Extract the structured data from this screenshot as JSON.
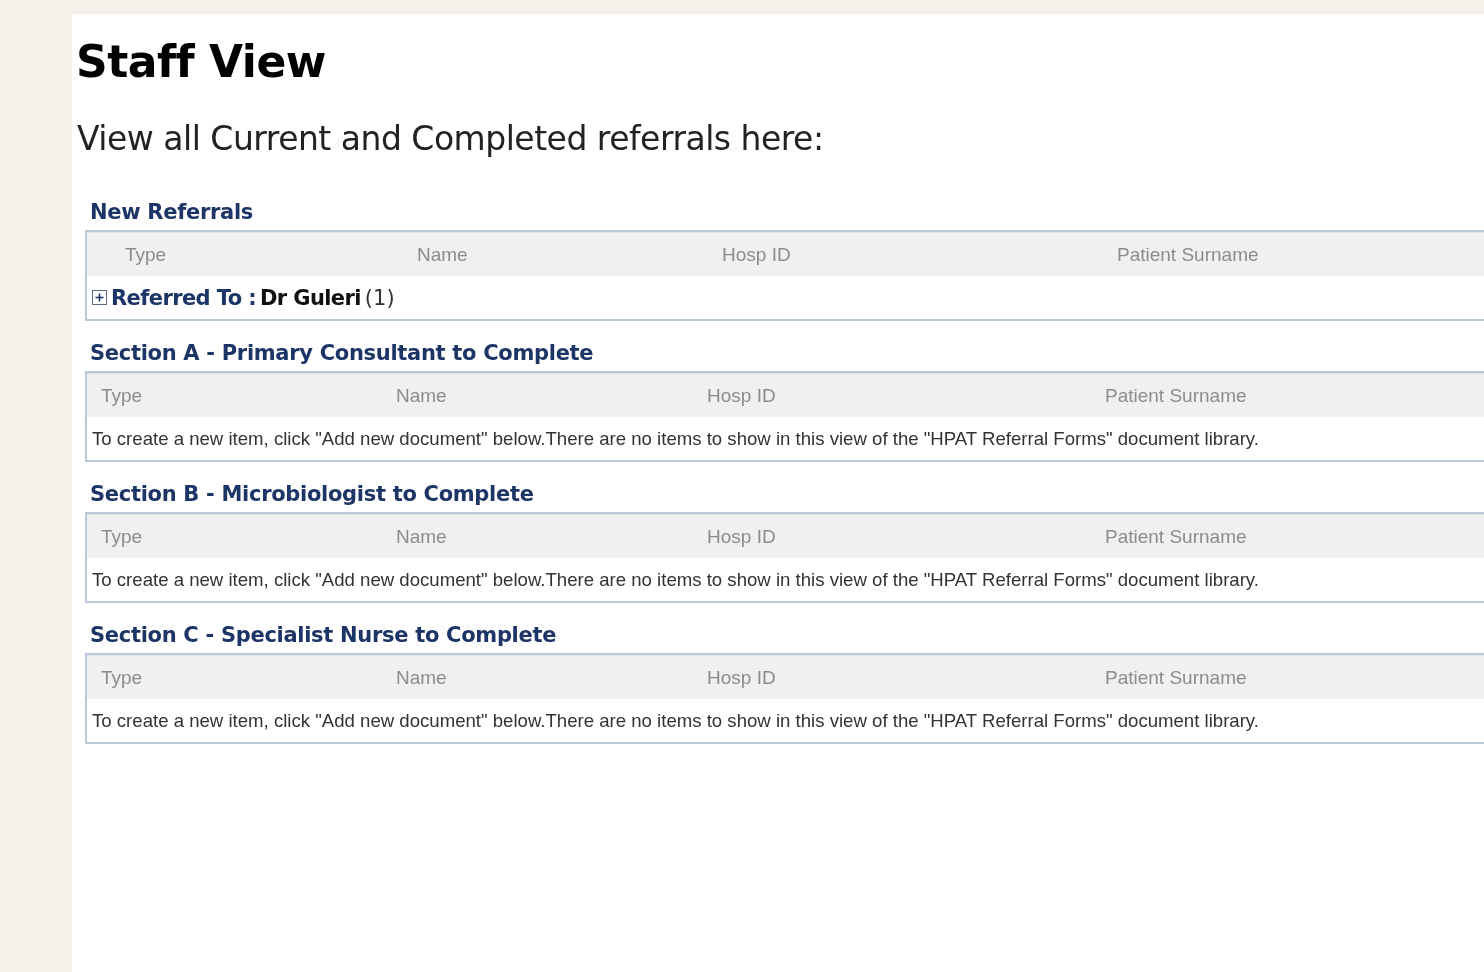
{
  "page": {
    "title": "Staff View",
    "subtitle": "View all Current and Completed referrals here:"
  },
  "sections": [
    {
      "kind": "grouped",
      "title": "New Referrals",
      "columns": [
        "Type",
        "Name",
        "Hosp ID",
        "Patient Surname"
      ],
      "group": {
        "label": "Referred To :",
        "value": "Dr Guleri",
        "count": "(1)",
        "expanded": false
      }
    },
    {
      "kind": "empty",
      "title": "Section A - Primary Consultant to Complete",
      "columns": [
        "Type",
        "Name",
        "Hosp ID",
        "Patient Surname"
      ],
      "message": "To create a new item, click \"Add new document\" below.There are no items to show in this view of the \"HPAT Referral Forms\" document library."
    },
    {
      "kind": "empty",
      "title": "Section B - Microbiologist to Complete",
      "columns": [
        "Type",
        "Name",
        "Hosp ID",
        "Patient Surname"
      ],
      "message": "To create a new item, click \"Add new document\" below.There are no items to show in this view of the \"HPAT Referral Forms\" document library."
    },
    {
      "kind": "empty",
      "title": "Section C - Specialist Nurse to Complete",
      "columns": [
        "Type",
        "Name",
        "Hosp ID",
        "Patient Surname"
      ],
      "message": "To create a new item, click \"Add new document\" below.There are no items to show in this view of the \"HPAT Referral Forms\" document library."
    }
  ]
}
